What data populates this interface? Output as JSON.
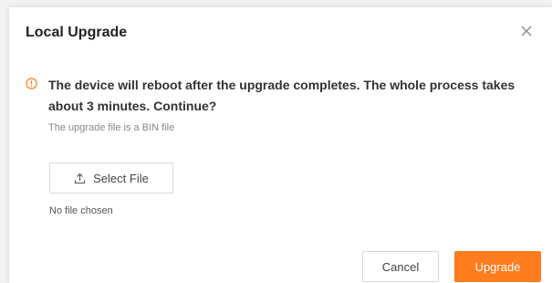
{
  "dialog": {
    "title": "Local Upgrade",
    "message": "The device will reboot after the upgrade completes. The whole process takes about 3 minutes. Continue?",
    "hint": "The upgrade file is a BIN file",
    "select_file_label": "Select File",
    "no_file_text": "No file chosen",
    "cancel_label": "Cancel",
    "upgrade_label": "Upgrade"
  },
  "colors": {
    "accent": "#ff7d1f",
    "warning": "#ff7d1f"
  },
  "icons": {
    "close": "close-icon",
    "warning": "warning-circle-icon",
    "upload": "upload-icon"
  }
}
